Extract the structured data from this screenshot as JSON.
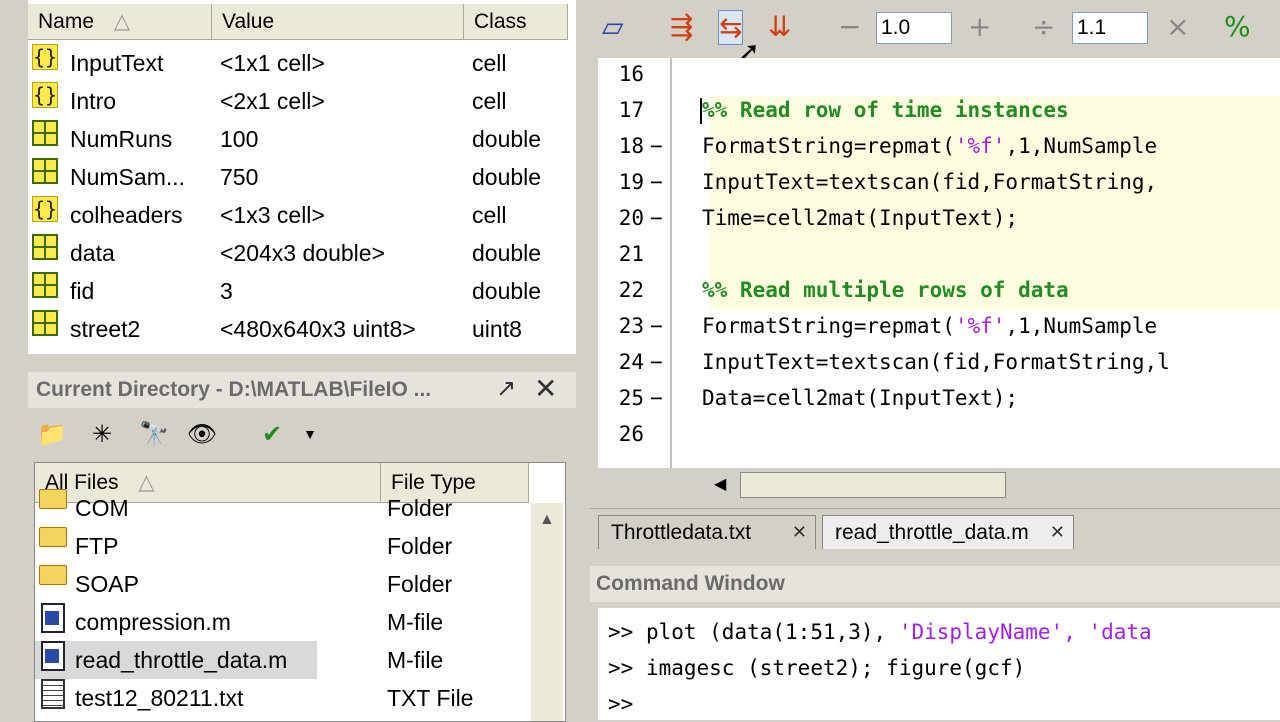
{
  "workspace": {
    "columns": {
      "name": "Name",
      "value": "Value",
      "class": "Class"
    },
    "sort_arrow": "△",
    "variables": [
      {
        "icon": "cell-icon",
        "name": "InputText",
        "value": "<1x1 cell>",
        "class": "cell"
      },
      {
        "icon": "cell-icon",
        "name": "Intro",
        "value": "<2x1 cell>",
        "class": "cell"
      },
      {
        "icon": "matrix-icon",
        "name": "NumRuns",
        "value": "100",
        "class": "double"
      },
      {
        "icon": "matrix-icon",
        "name": "NumSam...",
        "value": "750",
        "class": "double"
      },
      {
        "icon": "cell-icon",
        "name": "colheaders",
        "value": "<1x3 cell>",
        "class": "cell"
      },
      {
        "icon": "matrix-icon",
        "name": "data",
        "value": "<204x3 double>",
        "class": "double"
      },
      {
        "icon": "matrix-icon",
        "name": "fid",
        "value": "3",
        "class": "double"
      },
      {
        "icon": "matrix-icon",
        "name": "street2",
        "value": "<480x640x3 uint8>",
        "class": "uint8"
      }
    ],
    "cell_glyph": "{}"
  },
  "current_directory": {
    "title": "Current Directory - D:\\MATLAB\\FileIO ...",
    "columns": {
      "all_files": "All Files",
      "file_type": "File Type"
    },
    "files": [
      {
        "icon": "folder-icon",
        "name": "COM",
        "type": "Folder"
      },
      {
        "icon": "folder-icon",
        "name": "FTP",
        "type": "Folder"
      },
      {
        "icon": "folder-icon",
        "name": "SOAP",
        "type": "Folder"
      },
      {
        "icon": "m-file-icon",
        "name": "compression.m",
        "type": "M-file"
      },
      {
        "icon": "m-file-icon",
        "name": "read_throttle_data.m",
        "type": "M-file",
        "selected": true
      },
      {
        "icon": "txt-file-icon",
        "name": "test12_80211.txt",
        "type": "TXT File"
      }
    ]
  },
  "editor": {
    "zoom_minus": "−",
    "zoom_plus": "+",
    "zoom_value": "1.0",
    "divide": "÷",
    "divide_value": "1.1",
    "times": "×",
    "lines": [
      {
        "num": "16",
        "dash": "",
        "code": ""
      },
      {
        "num": "17",
        "dash": "",
        "code": "%% Read row of time instances",
        "kind": "comment"
      },
      {
        "num": "18",
        "dash": "−",
        "code": "FormatString=repmat(",
        "str": "'%f'",
        "rest": ",1,NumSample"
      },
      {
        "num": "19",
        "dash": "−",
        "code": "InputText=textscan(fid,FormatString,"
      },
      {
        "num": "20",
        "dash": "−",
        "code": "Time=cell2mat(InputText);"
      },
      {
        "num": "21",
        "dash": "",
        "code": ""
      },
      {
        "num": "22",
        "dash": "",
        "code": "%% Read multiple rows of data",
        "kind": "comment"
      },
      {
        "num": "23",
        "dash": "−",
        "code": "FormatString=repmat(",
        "str": "'%f'",
        "rest": ",1,NumSample"
      },
      {
        "num": "24",
        "dash": "−",
        "code": "InputText=textscan(fid,FormatString,l"
      },
      {
        "num": "25",
        "dash": "−",
        "code": "Data=cell2mat(InputText);"
      },
      {
        "num": "26",
        "dash": "",
        "code": ""
      }
    ],
    "tabs": [
      {
        "label": "Throttledata.txt"
      },
      {
        "label": "read_throttle_data.m",
        "active": true
      }
    ]
  },
  "command_window": {
    "title": "Command Window",
    "lines": [
      {
        "prompt": ">>",
        "text": "plot (data(1:51,3), ",
        "str": "'DisplayName', 'data"
      },
      {
        "prompt": ">>",
        "text": "imagesc (street2); figure(gcf)"
      },
      {
        "prompt": ">>",
        "text": ""
      }
    ]
  }
}
